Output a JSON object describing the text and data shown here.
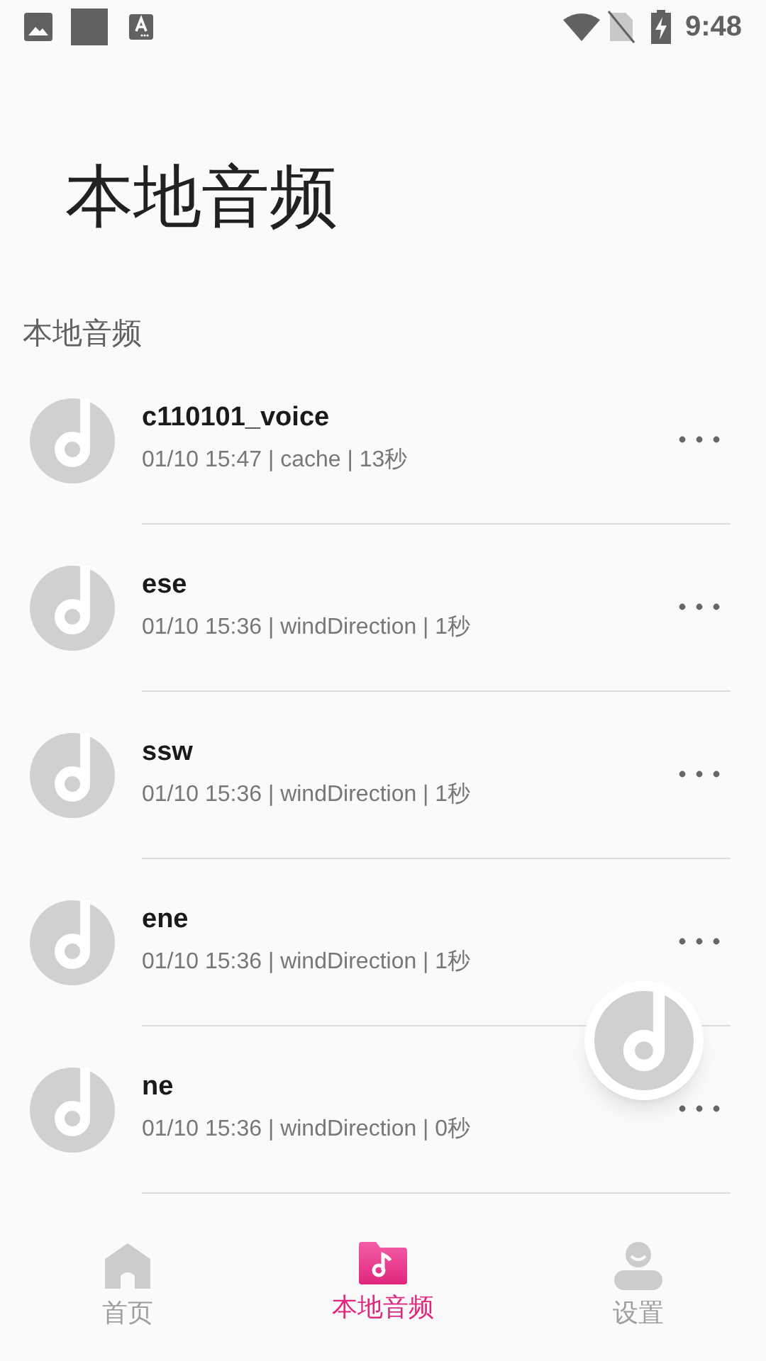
{
  "status_bar": {
    "time": "9:48"
  },
  "page_title": "本地音频",
  "section_label": "本地音频",
  "tracks": [
    {
      "name": "c110101_voice",
      "meta": "01/10 15:47 | cache | 13秒"
    },
    {
      "name": "ese",
      "meta": "01/10 15:36 | windDirection | 1秒"
    },
    {
      "name": "ssw",
      "meta": "01/10 15:36 | windDirection | 1秒"
    },
    {
      "name": "ene",
      "meta": "01/10 15:36 | windDirection | 1秒"
    },
    {
      "name": "ne",
      "meta": "01/10 15:36 | windDirection | 0秒"
    }
  ],
  "bottom_nav": [
    {
      "kind": "home",
      "label": "首页",
      "selected": false
    },
    {
      "kind": "music",
      "label": "本地音频",
      "selected": true
    },
    {
      "kind": "person",
      "label": "设置",
      "selected": false
    }
  ]
}
